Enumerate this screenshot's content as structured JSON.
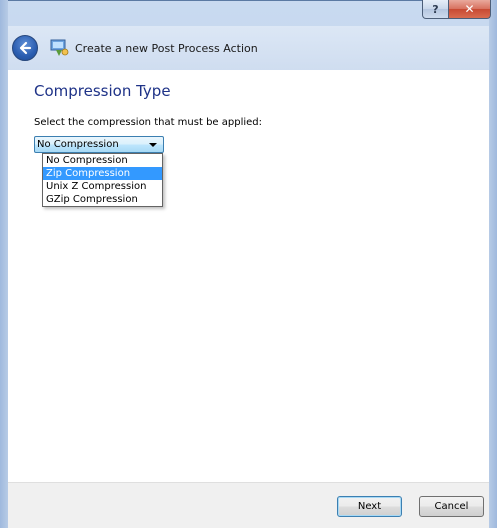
{
  "window": {
    "help_label": "?",
    "close_label": "✕"
  },
  "header": {
    "title": "Create a new Post Process Action"
  },
  "page": {
    "heading": "Compression Type",
    "instruction": "Select the compression that must be applied:"
  },
  "compression_select": {
    "selected_value": "No Compression",
    "options": [
      "No Compression",
      "Zip Compression",
      "Unix Z Compression",
      "GZip Compression"
    ],
    "highlighted_index": 1
  },
  "footer": {
    "next_label": "Next",
    "cancel_label": "Cancel"
  },
  "colors": {
    "heading": "#1e3287",
    "highlight": "#3399ff",
    "close_button": "#c74a33"
  }
}
